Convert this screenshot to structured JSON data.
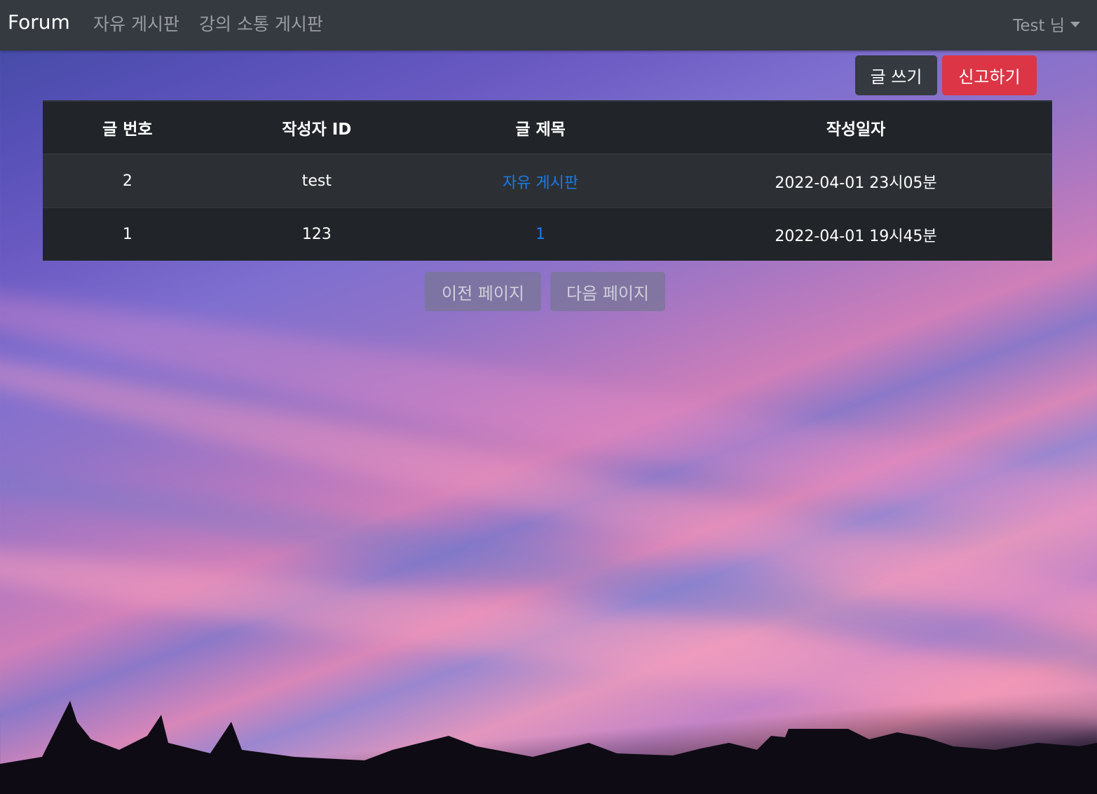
{
  "navbar": {
    "brand": "Forum",
    "links": [
      {
        "label": "자유 게시판"
      },
      {
        "label": "강의 소통 게시판"
      }
    ],
    "user_label": "Test 님"
  },
  "actions": {
    "write_label": "글 쓰기",
    "report_label": "신고하기"
  },
  "table": {
    "headers": [
      "글 번호",
      "작성자 ID",
      "글 제목",
      "작성일자"
    ],
    "rows": [
      {
        "no": "2",
        "author": "test",
        "title": "자유 게시판",
        "date": "2022-04-01 23시05분"
      },
      {
        "no": "1",
        "author": "123",
        "title": "1",
        "date": "2022-04-01 19시45분"
      }
    ]
  },
  "pagination": {
    "prev_label": "이전 페이지",
    "next_label": "다음 페이지"
  },
  "colors": {
    "navbar_bg": "#343a40",
    "danger": "#dc3545",
    "link": "#1a7ae8"
  }
}
